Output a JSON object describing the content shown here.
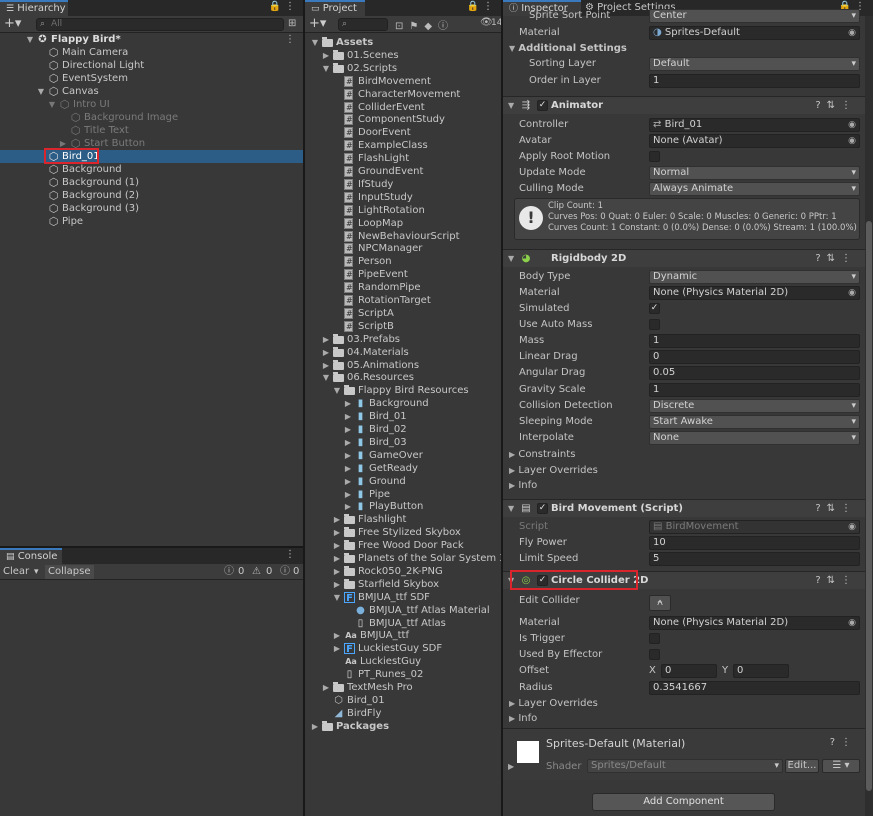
{
  "hierarchy": {
    "tab": "Hierarchy",
    "search_placeholder": "All",
    "scene": "Flappy Bird*",
    "items": [
      {
        "label": "Main Camera"
      },
      {
        "label": "Directional Light"
      },
      {
        "label": "EventSystem"
      },
      {
        "label": "Canvas"
      },
      {
        "label": "Intro UI"
      },
      {
        "label": "Background Image"
      },
      {
        "label": "Title Text"
      },
      {
        "label": "Start Button"
      },
      {
        "label": "Bird_01"
      },
      {
        "label": "Background"
      },
      {
        "label": "Background (1)"
      },
      {
        "label": "Background (2)"
      },
      {
        "label": "Background (3)"
      },
      {
        "label": "Pipe"
      }
    ]
  },
  "console": {
    "tab": "Console",
    "clear": "Clear",
    "collapse": "Collapse",
    "log_count": "0",
    "warn_count": "0",
    "error_count": "0"
  },
  "project": {
    "tab": "Project",
    "hidden_count": "14",
    "items": [
      {
        "label": "Assets"
      },
      {
        "label": "01.Scenes"
      },
      {
        "label": "02.Scripts"
      },
      {
        "label": "BirdMovement"
      },
      {
        "label": "CharacterMovement"
      },
      {
        "label": "ColliderEvent"
      },
      {
        "label": "ComponentStudy"
      },
      {
        "label": "DoorEvent"
      },
      {
        "label": "ExampleClass"
      },
      {
        "label": "FlashLight"
      },
      {
        "label": "GroundEvent"
      },
      {
        "label": "IfStudy"
      },
      {
        "label": "InputStudy"
      },
      {
        "label": "LightRotation"
      },
      {
        "label": "LoopMap"
      },
      {
        "label": "NewBehaviourScript"
      },
      {
        "label": "NPCManager"
      },
      {
        "label": "Person"
      },
      {
        "label": "PipeEvent"
      },
      {
        "label": "RandomPipe"
      },
      {
        "label": "RotationTarget"
      },
      {
        "label": "ScriptA"
      },
      {
        "label": "ScriptB"
      },
      {
        "label": "03.Prefabs"
      },
      {
        "label": "04.Materials"
      },
      {
        "label": "05.Animations"
      },
      {
        "label": "06.Resources"
      },
      {
        "label": "Flappy Bird Resources"
      },
      {
        "label": "Background"
      },
      {
        "label": "Bird_01"
      },
      {
        "label": "Bird_02"
      },
      {
        "label": "Bird_03"
      },
      {
        "label": "GameOver"
      },
      {
        "label": "GetReady"
      },
      {
        "label": "Ground"
      },
      {
        "label": "Pipe"
      },
      {
        "label": "PlayButton"
      },
      {
        "label": "Flashlight"
      },
      {
        "label": "Free Stylized Skybox"
      },
      {
        "label": "Free Wood Door Pack"
      },
      {
        "label": "Planets of the Solar System 3D"
      },
      {
        "label": "Rock050_2K-PNG"
      },
      {
        "label": "Starfield Skybox"
      },
      {
        "label": "BMJUA_ttf SDF"
      },
      {
        "label": "BMJUA_ttf Atlas Material"
      },
      {
        "label": "BMJUA_ttf Atlas"
      },
      {
        "label": "BMJUA_ttf"
      },
      {
        "label": "LuckiestGuy SDF"
      },
      {
        "label": "LuckiestGuy"
      },
      {
        "label": "PT_Runes_02"
      },
      {
        "label": "TextMesh Pro"
      },
      {
        "label": "Bird_01"
      },
      {
        "label": "BirdFly"
      },
      {
        "label": "Packages"
      }
    ]
  },
  "inspector": {
    "tab": "Inspector",
    "tab2": "Project Settings",
    "top": {
      "sprite_sort_point_label": "Sprite Sort Point",
      "sprite_sort_point_value": "Center",
      "material_label": "Material",
      "material_value": "Sprites-Default",
      "additional_settings": "Additional Settings",
      "sorting_layer_label": "Sorting Layer",
      "sorting_layer_value": "Default",
      "order_label": "Order in Layer",
      "order_value": "1"
    },
    "animator": {
      "title": "Animator",
      "controller_label": "Controller",
      "controller_value": "Bird_01",
      "avatar_label": "Avatar",
      "avatar_value": "None (Avatar)",
      "root_motion_label": "Apply Root Motion",
      "update_mode_label": "Update Mode",
      "update_mode_value": "Normal",
      "culling_label": "Culling Mode",
      "culling_value": "Always Animate",
      "info_line1": "Clip Count: 1",
      "info_line2": "Curves Pos: 0 Quat: 0 Euler: 0 Scale: 0 Muscles: 0 Generic: 0 PPtr: 1",
      "info_line3": "Curves Count: 1 Constant: 0 (0.0%) Dense: 0 (0.0%) Stream: 1 (100.0%)"
    },
    "rigidbody": {
      "title": "Rigidbody 2D",
      "body_type_label": "Body Type",
      "body_type_value": "Dynamic",
      "material_label": "Material",
      "material_value": "None (Physics Material 2D)",
      "simulated_label": "Simulated",
      "auto_mass_label": "Use Auto Mass",
      "mass_label": "Mass",
      "mass_value": "1",
      "linear_drag_label": "Linear Drag",
      "linear_drag_value": "0",
      "angular_drag_label": "Angular Drag",
      "angular_drag_value": "0.05",
      "gravity_label": "Gravity Scale",
      "gravity_value": "1",
      "collision_label": "Collision Detection",
      "collision_value": "Discrete",
      "sleeping_label": "Sleeping Mode",
      "sleeping_value": "Start Awake",
      "interpolate_label": "Interpolate",
      "interpolate_value": "None",
      "constraints": "Constraints",
      "layer_overrides": "Layer Overrides",
      "info": "Info"
    },
    "bird_movement": {
      "title": "Bird Movement (Script)",
      "script_label": "Script",
      "script_value": "BirdMovement",
      "fly_power_label": "Fly Power",
      "fly_power_value": "10",
      "limit_speed_label": "Limit Speed",
      "limit_speed_value": "5"
    },
    "circle_collider": {
      "title": "Circle Collider 2D",
      "edit_collider_label": "Edit Collider",
      "material_label": "Material",
      "material_value": "None (Physics Material 2D)",
      "is_trigger_label": "Is Trigger",
      "effector_label": "Used By Effector",
      "offset_label": "Offset",
      "offset_x_label": "X",
      "offset_x_value": "0",
      "offset_y_label": "Y",
      "offset_y_value": "0",
      "radius_label": "Radius",
      "radius_value": "0.3541667",
      "layer_overrides": "Layer Overrides",
      "info": "Info"
    },
    "material": {
      "title": "Sprites-Default (Material)",
      "shader_label": "Shader",
      "shader_value": "Sprites/Default",
      "edit_button": "Edit..."
    },
    "add_component": "Add Component"
  },
  "colors": {
    "selection": "#2c5d87",
    "highlight_box": "#d9252b",
    "tab_accent": "#3a79bb"
  }
}
